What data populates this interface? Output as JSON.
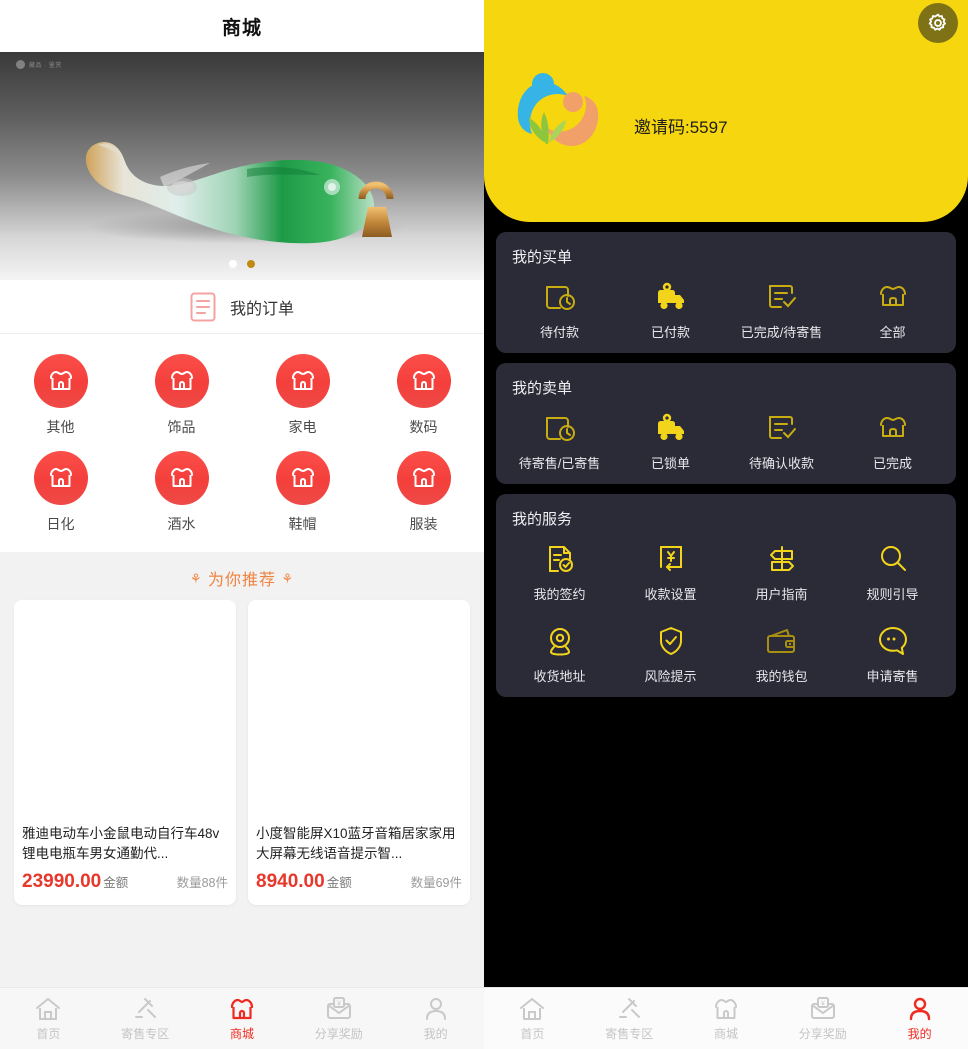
{
  "left": {
    "topbar": {
      "title": "商城"
    },
    "banner": {
      "watermark": "藏品 · 鉴赏",
      "dots": 2,
      "active_dot": 1,
      "image_alt": "翡翠玉鱼挂件"
    },
    "order_entry": {
      "label": "我的订单",
      "icon": "document-icon"
    },
    "categories": [
      {
        "label": "其他",
        "icon": "shop-icon"
      },
      {
        "label": "饰品",
        "icon": "shop-icon"
      },
      {
        "label": "家电",
        "icon": "shop-icon"
      },
      {
        "label": "数码",
        "icon": "shop-icon"
      },
      {
        "label": "日化",
        "icon": "shop-icon"
      },
      {
        "label": "酒水",
        "icon": "shop-icon"
      },
      {
        "label": "鞋帽",
        "icon": "shop-icon"
      },
      {
        "label": "服装",
        "icon": "shop-icon"
      }
    ],
    "recommend": {
      "title": "为你推荐",
      "ornament": "⚘"
    },
    "products": [
      {
        "title": "雅迪电动车小金鼠电动自行车48v锂电电瓶车男女通勤代...",
        "price": "23990.00",
        "price_unit": "金额",
        "qty": "数量88件"
      },
      {
        "title": "小度智能屏X10蓝牙音箱居家家用大屏幕无线语音提示智...",
        "price": "8940.00",
        "price_unit": "金额",
        "qty": "数量69件"
      }
    ],
    "tabbar": {
      "active_index": 2,
      "items": [
        {
          "label": "首页",
          "icon": "home-icon"
        },
        {
          "label": "寄售专区",
          "icon": "gavel-icon"
        },
        {
          "label": "商城",
          "icon": "shop-icon"
        },
        {
          "label": "分享奖励",
          "icon": "envelope-reward-icon"
        },
        {
          "label": "我的",
          "icon": "person-icon"
        }
      ]
    }
  },
  "right": {
    "hero": {
      "invite_code": "邀请码:5597",
      "settings_icon": "gear-icon",
      "logo_alt": "公益人形标志"
    },
    "buy_orders": {
      "title": "我的买单",
      "items": [
        {
          "label": "待付款",
          "icon": "wallet-clock-icon"
        },
        {
          "label": "已付款",
          "icon": "delivery-truck-icon"
        },
        {
          "label": "已完成/待寄售",
          "icon": "list-check-icon"
        },
        {
          "label": "全部",
          "icon": "shop-icon"
        }
      ]
    },
    "sell_orders": {
      "title": "我的卖单",
      "items": [
        {
          "label": "待寄售/已寄售",
          "icon": "wallet-clock-icon"
        },
        {
          "label": "已锁单",
          "icon": "delivery-truck-icon"
        },
        {
          "label": "待确认收款",
          "icon": "list-check-icon"
        },
        {
          "label": "已完成",
          "icon": "shop-icon"
        }
      ]
    },
    "services": {
      "title": "我的服务",
      "items": [
        {
          "label": "我的签约",
          "icon": "contract-check-icon"
        },
        {
          "label": "收款设置",
          "icon": "yuan-receipt-icon"
        },
        {
          "label": "用户指南",
          "icon": "signpost-icon"
        },
        {
          "label": "规则引导",
          "icon": "search-icon"
        },
        {
          "label": "收货地址",
          "icon": "location-pin-icon"
        },
        {
          "label": "风险提示",
          "icon": "shield-check-icon"
        },
        {
          "label": "我的钱包",
          "icon": "wallet-icon"
        },
        {
          "label": "申请寄售",
          "icon": "chat-bubble-icon"
        }
      ]
    },
    "tabbar": {
      "active_index": 4,
      "items": [
        {
          "label": "首页",
          "icon": "home-icon"
        },
        {
          "label": "寄售专区",
          "icon": "gavel-icon"
        },
        {
          "label": "商城",
          "icon": "shop-icon"
        },
        {
          "label": "分享奖励",
          "icon": "envelope-reward-icon"
        },
        {
          "label": "我的",
          "icon": "person-icon"
        }
      ]
    }
  },
  "colors": {
    "brand_yellow": "#f6d60e",
    "card_dark": "#2b2b38",
    "accent_red": "#ef2a20",
    "price_red": "#e8372b",
    "recommend_orange": "#f08340",
    "icon_yellow": "#f2d41a"
  }
}
